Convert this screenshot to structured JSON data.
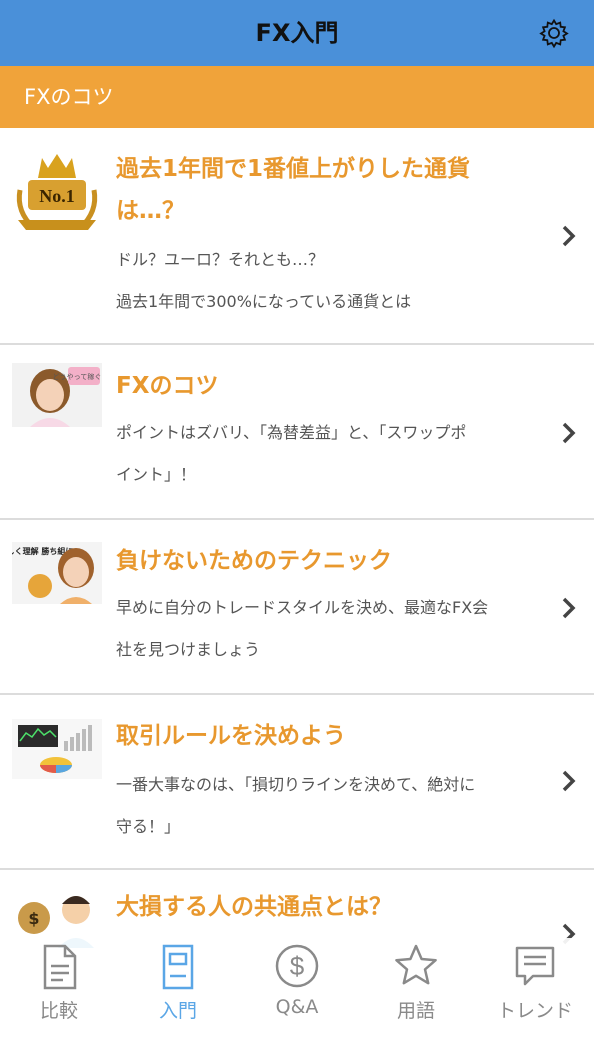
{
  "header": {
    "title": "FX入門"
  },
  "section": {
    "title": "FXのコツ"
  },
  "articles": [
    {
      "title": "過去1年間で1番値上がりした通貨は…？",
      "description_lines": [
        "ドル？ユーロ？それとも…？",
        "過去1年間で300%になっている通貨とは"
      ],
      "thumb_text": "No.1"
    },
    {
      "title": "FXのコツ",
      "description_lines": [
        "ポイントはズバリ、「為替差益」と、「スワップポ",
        "イント」！"
      ],
      "thumb_text": "どうやって稼ぐの？"
    },
    {
      "title": "負けないためのテクニック",
      "description_lines": [
        "早めに自分のトレードスタイルを決め、最適なFX会",
        "社を見つけましょう"
      ],
      "thumb_text": "正しく理解 勝ち組に"
    },
    {
      "title": "取引ルールを決めよう",
      "description_lines": [
        "一番大事なのは、「損切りラインを決めて、絶対に",
        "守る！」"
      ]
    },
    {
      "title": "大損する人の共通点とは？",
      "description_lines": []
    }
  ],
  "tabs": [
    {
      "label": "比較",
      "icon": "document-icon",
      "active": false
    },
    {
      "label": "入門",
      "icon": "book-icon",
      "active": true
    },
    {
      "label": "Q&A",
      "icon": "dollar-icon",
      "active": false
    },
    {
      "label": "用語",
      "icon": "star-icon",
      "active": false
    },
    {
      "label": "トレンド",
      "icon": "chat-icon",
      "active": false
    }
  ],
  "colors": {
    "header": "#4A90D9",
    "section": "#F0A33A",
    "title": "#E8982E",
    "tab_active": "#5AA6E6",
    "tab_inactive": "#8a8a8a"
  }
}
